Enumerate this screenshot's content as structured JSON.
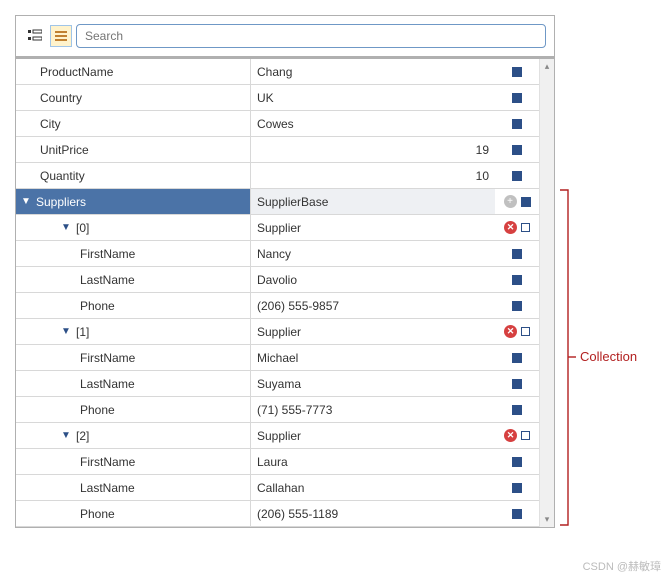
{
  "search": {
    "placeholder": "Search"
  },
  "rows": {
    "productName": {
      "label": "ProductName",
      "value": "Chang"
    },
    "country": {
      "label": "Country",
      "value": "UK"
    },
    "city": {
      "label": "City",
      "value": "Cowes"
    },
    "unitPrice": {
      "label": "UnitPrice",
      "value": "19"
    },
    "quantity": {
      "label": "Quantity",
      "value": "10"
    },
    "suppliers": {
      "label": "Suppliers",
      "value": "SupplierBase"
    }
  },
  "suppliers": [
    {
      "idx": "[0]",
      "type": "Supplier",
      "firstName": "Nancy",
      "lastName": "Davolio",
      "phone": "(206) 555-9857"
    },
    {
      "idx": "[1]",
      "type": "Supplier",
      "firstName": "Michael",
      "lastName": "Suyama",
      "phone": "(71) 555-7773"
    },
    {
      "idx": "[2]",
      "type": "Supplier",
      "firstName": "Laura",
      "lastName": "Callahan",
      "phone": "(206) 555-1189"
    }
  ],
  "fieldLabels": {
    "firstName": "FirstName",
    "lastName": "LastName",
    "phone": "Phone"
  },
  "annotation": "Collection",
  "watermark": "CSDN @赫敏璋"
}
